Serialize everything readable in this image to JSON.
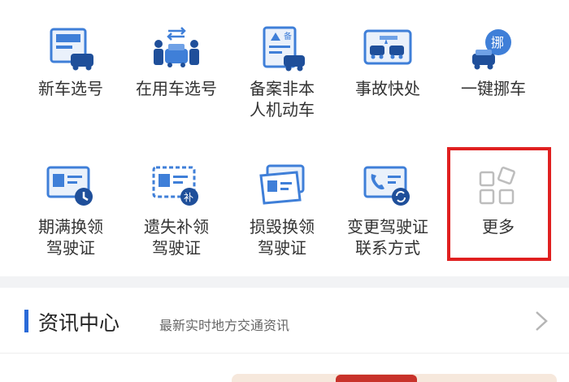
{
  "services": {
    "row1": [
      {
        "label": "新车选号",
        "icon": "new-car-plate-icon"
      },
      {
        "label": "在用车选号",
        "icon": "used-car-plate-icon"
      },
      {
        "label": "备案非本\n人机动车",
        "icon": "vehicle-registration-icon"
      },
      {
        "label": "事故快处",
        "icon": "accident-handling-icon"
      },
      {
        "label": "一键挪车",
        "icon": "move-car-icon"
      }
    ],
    "row2": [
      {
        "label": "期满换领\n驾驶证",
        "icon": "license-renewal-icon"
      },
      {
        "label": "遗失补领\n驾驶证",
        "icon": "license-reissue-icon"
      },
      {
        "label": "损毁换领\n驾驶证",
        "icon": "license-replace-damaged-icon"
      },
      {
        "label": "变更驾驶证\n联系方式",
        "icon": "change-contact-icon"
      },
      {
        "label": "更多",
        "icon": "more-grid-icon"
      }
    ],
    "move_car_badge": "挪",
    "reissue_badge": "补",
    "registration_badge": "备"
  },
  "news": {
    "title": "资讯中心",
    "subtitle": "最新实时地方交通资讯"
  },
  "colors": {
    "accent": "#2a6ad8",
    "highlight": "#e02020"
  }
}
